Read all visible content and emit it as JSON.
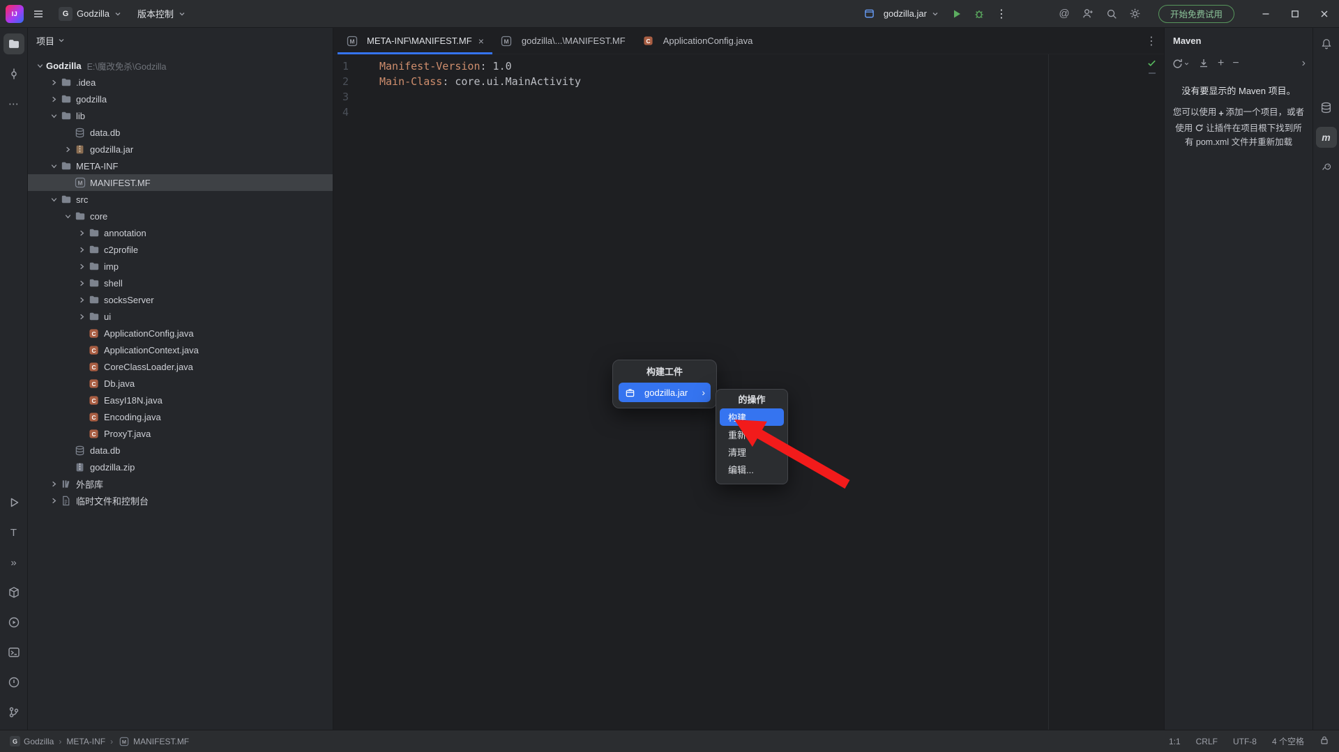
{
  "titlebar": {
    "logo_text": "IJ",
    "project_name": "Godzilla",
    "project_initial": "G",
    "vcs_label": "版本控制",
    "run_config": "godzilla.jar",
    "trial_button": "开始免费试用"
  },
  "project_panel": {
    "title": "项目",
    "tree": [
      {
        "label": "Godzilla",
        "path": "E:\\魔改免杀\\Godzilla",
        "level": 0,
        "icon": null,
        "chev": "open",
        "bold": true
      },
      {
        "label": ".idea",
        "level": 1,
        "icon": "folder",
        "chev": "closed"
      },
      {
        "label": "godzilla",
        "level": 1,
        "icon": "folder",
        "chev": "closed"
      },
      {
        "label": "lib",
        "level": 1,
        "icon": "folder",
        "chev": "open"
      },
      {
        "label": "data.db",
        "level": 2,
        "icon": "db"
      },
      {
        "label": "godzilla.jar",
        "level": 2,
        "icon": "jar",
        "chev": "closed"
      },
      {
        "label": "META-INF",
        "level": 1,
        "icon": "folder",
        "chev": "open"
      },
      {
        "label": "MANIFEST.MF",
        "level": 2,
        "icon": "manifest",
        "selected": true
      },
      {
        "label": "src",
        "level": 1,
        "icon": "folder",
        "chev": "open"
      },
      {
        "label": "core",
        "level": 2,
        "icon": "folder",
        "chev": "open"
      },
      {
        "label": "annotation",
        "level": 3,
        "icon": "folder",
        "chev": "closed"
      },
      {
        "label": "c2profile",
        "level": 3,
        "icon": "folder",
        "chev": "closed"
      },
      {
        "label": "imp",
        "level": 3,
        "icon": "folder",
        "chev": "closed"
      },
      {
        "label": "shell",
        "level": 3,
        "icon": "folder",
        "chev": "closed"
      },
      {
        "label": "socksServer",
        "level": 3,
        "icon": "folder",
        "chev": "closed"
      },
      {
        "label": "ui",
        "level": 3,
        "icon": "folder",
        "chev": "closed"
      },
      {
        "label": "ApplicationConfig.java",
        "level": 3,
        "icon": "class"
      },
      {
        "label": "ApplicationContext.java",
        "level": 3,
        "icon": "class"
      },
      {
        "label": "CoreClassLoader.java",
        "level": 3,
        "icon": "class"
      },
      {
        "label": "Db.java",
        "level": 3,
        "icon": "class"
      },
      {
        "label": "EasyI18N.java",
        "level": 3,
        "icon": "class"
      },
      {
        "label": "Encoding.java",
        "level": 3,
        "icon": "class"
      },
      {
        "label": "ProxyT.java",
        "level": 3,
        "icon": "class"
      },
      {
        "label": "data.db",
        "level": 2,
        "icon": "db"
      },
      {
        "label": "godzilla.zip",
        "level": 2,
        "icon": "zip"
      },
      {
        "label": "外部库",
        "level": 1,
        "icon": "lib",
        "chev": "closed"
      },
      {
        "label": "临时文件和控制台",
        "level": 1,
        "icon": "scratch",
        "chev": "closed"
      }
    ]
  },
  "editor": {
    "tabs": [
      {
        "label": "META-INF\\MANIFEST.MF",
        "icon": "manifest",
        "active": true
      },
      {
        "label": "godzilla\\...\\MANIFEST.MF",
        "icon": "manifest"
      },
      {
        "label": "ApplicationConfig.java",
        "icon": "class"
      }
    ],
    "lines": [
      {
        "num": "1",
        "tokens": [
          {
            "text": "Manifest-Version",
            "cls": "key"
          },
          {
            "text": ": 1.0",
            "cls": "plain"
          }
        ]
      },
      {
        "num": "2",
        "tokens": [
          {
            "text": "Main-Class",
            "cls": "key"
          },
          {
            "text": ": core.ui.MainActivity",
            "cls": "plain"
          }
        ]
      },
      {
        "num": "3",
        "tokens": []
      },
      {
        "num": "4",
        "tokens": []
      }
    ]
  },
  "popup_build_artifacts": {
    "title": "构建工件",
    "item_label": "godzilla.jar"
  },
  "popup_actions": {
    "title": "的操作",
    "items": [
      {
        "label": "构建",
        "selected": true
      },
      {
        "label": "重新构建"
      },
      {
        "label": "清理"
      },
      {
        "label": "编辑..."
      }
    ]
  },
  "maven_panel": {
    "title": "Maven",
    "empty_title": "没有要显示的 Maven 项目。",
    "hint_p1": "您可以使用",
    "hint_p2": "添加一个项目，或者使用",
    "hint_p3": "让插件在项目根下找到所有 pom.xml 文件并重新加载"
  },
  "status_bar": {
    "breadcrumbs": [
      "Godzilla",
      "META-INF",
      "MANIFEST.MF"
    ],
    "caret_position": "1:1",
    "line_separator": "CRLF",
    "encoding": "UTF-8",
    "indent": "4 个空格"
  },
  "colors": {
    "accent_blue": "#3574f0",
    "selection_gray": "#3e4145",
    "annotation_red": "#f21b1b",
    "trial_green": "#57965c",
    "key_orange": "#cf8e6d"
  }
}
